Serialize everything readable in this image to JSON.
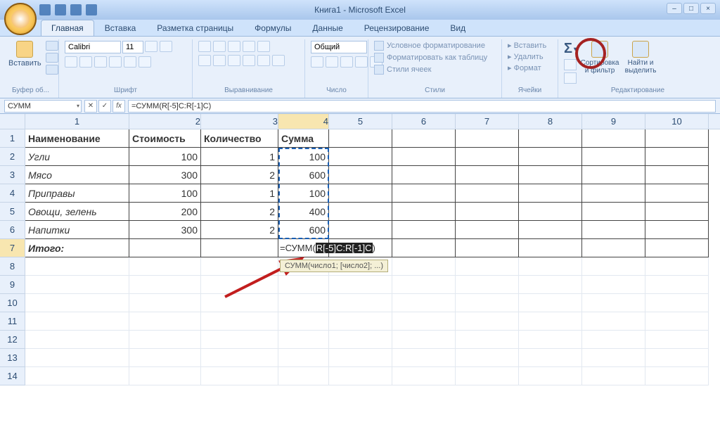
{
  "title": "Книга1 - Microsoft Excel",
  "tabs": [
    "Главная",
    "Вставка",
    "Разметка страницы",
    "Формулы",
    "Данные",
    "Рецензирование",
    "Вид"
  ],
  "active_tab": 0,
  "ribbon": {
    "clipboard": {
      "label": "Буфер об...",
      "paste": "Вставить"
    },
    "font": {
      "label": "Шрифт",
      "name": "Calibri",
      "size": "11"
    },
    "align": {
      "label": "Выравнивание"
    },
    "number": {
      "label": "Число",
      "format": "Общий"
    },
    "styles": {
      "label": "Стили",
      "cond": "Условное форматирование",
      "table": "Форматировать как таблицу",
      "cell": "Стили ячеек"
    },
    "cells": {
      "label": "Ячейки",
      "insert": "Вставить",
      "delete": "Удалить",
      "format": "Формат"
    },
    "editing": {
      "label": "Редактирование",
      "sort": "Сортировка и фильтр",
      "find": "Найти и выделить"
    }
  },
  "namebox": "СУММ",
  "formula_bar": "=СУММ(R[-5]C:R[-1]C)",
  "columns": [
    "1",
    "2",
    "3",
    "4",
    "5",
    "6",
    "7",
    "8",
    "9",
    "10"
  ],
  "active_col_index": 3,
  "row_headers": [
    "1",
    "2",
    "3",
    "4",
    "5",
    "6",
    "7",
    "8",
    "9",
    "10",
    "11",
    "12",
    "13",
    "14"
  ],
  "active_row_index": 6,
  "table": {
    "headers": [
      "Наименование",
      "Стоимость",
      "Количество",
      "Сумма"
    ],
    "rows": [
      [
        "Угли",
        "100",
        "1",
        "100"
      ],
      [
        "Мясо",
        "300",
        "2",
        "600"
      ],
      [
        "Приправы",
        "100",
        "1",
        "100"
      ],
      [
        "Овощи, зелень",
        "200",
        "2",
        "400"
      ],
      [
        "Напитки",
        "300",
        "2",
        "600"
      ]
    ],
    "total_label": "Итого:"
  },
  "formula_in_cell": {
    "prefix": "=СУММ(",
    "selection": "R[-5]C:R[-1]C",
    "suffix": ""
  },
  "tooltip": "СУММ(число1; [число2]; ...)"
}
